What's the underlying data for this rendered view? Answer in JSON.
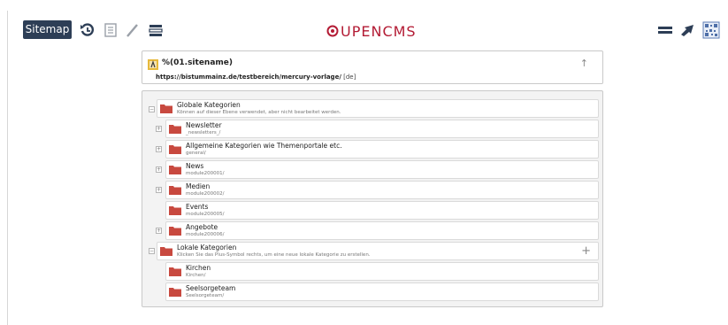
{
  "toolbar": {
    "sitemap_label": "Sitemap",
    "logo_text": "UPENCMS",
    "icons": [
      "history-icon",
      "list-icon",
      "wand-icon",
      "gallery-icon",
      "menu-icon",
      "publish-icon",
      "qr-icon"
    ]
  },
  "site": {
    "title": "%(01.sitename)",
    "url": "https://bistummainz.de/testbereich/mercury-vorlage/",
    "lang": "[de]"
  },
  "tree": [
    {
      "title": "Globale Kategorien",
      "sub": "Können auf dieser Ebene verwendet, aber nicht bearbeitet werden."
    },
    {
      "title": "Newsletter",
      "sub": "_newsletters_/"
    },
    {
      "title": "Allgemeine Kategorien wie Themenportale etc.",
      "sub": "general/"
    },
    {
      "title": "News",
      "sub": "module200001/"
    },
    {
      "title": "Medien",
      "sub": "module200002/"
    },
    {
      "title": "Events",
      "sub": "module200005/"
    },
    {
      "title": "Angebote",
      "sub": "module200006/"
    },
    {
      "title": "Lokale Kategorien",
      "sub": "Klicken Sie das Plus-Symbol rechts, um eine neue lokale Kategorie zu erstellen."
    },
    {
      "title": "Kirchen",
      "sub": "Kirchen/"
    },
    {
      "title": "Seelsorgeteam",
      "sub": "Seelsorgeteam/"
    }
  ],
  "colors": {
    "folder": "#c8493f",
    "brand": "#b31b34",
    "button": "#2d3e56"
  }
}
